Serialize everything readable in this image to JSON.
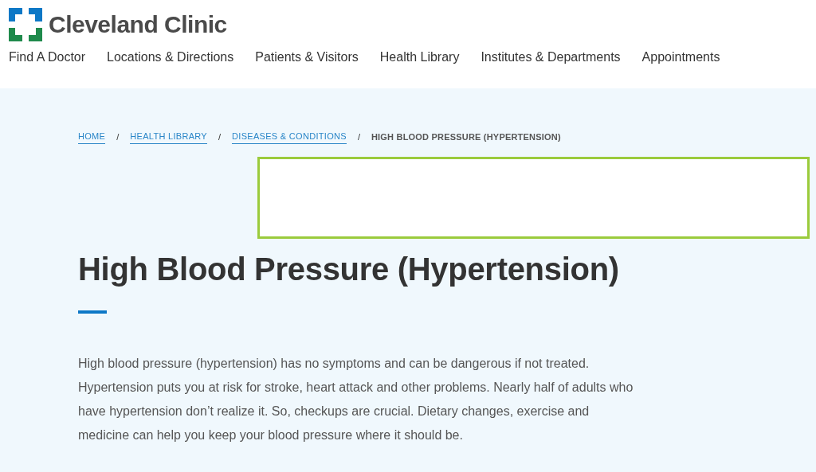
{
  "logo": {
    "text": "Cleveland Clinic"
  },
  "nav": [
    {
      "label": "Find A Doctor"
    },
    {
      "label": "Locations & Directions"
    },
    {
      "label": "Patients & Visitors"
    },
    {
      "label": "Health Library"
    },
    {
      "label": "Institutes & Departments"
    },
    {
      "label": "Appointments"
    }
  ],
  "breadcrumb": [
    {
      "label": "HOME",
      "current": false
    },
    {
      "label": "HEALTH LIBRARY",
      "current": false
    },
    {
      "label": "DISEASES & CONDITIONS",
      "current": false
    },
    {
      "label": "HIGH BLOOD PRESSURE (HYPERTENSION)",
      "current": true
    }
  ],
  "breadcrumb_separator": "/",
  "title": "High Blood Pressure (Hypertension)",
  "intro": "High blood pressure (hypertension) has no symptoms and can be dangerous if not treated. Hypertension puts you at risk for stroke, heart attack and other problems. Nearly half of adults who have hypertension don’t realize it. So, checkups are crucial. Dietary changes, exercise and medicine can help you keep your blood pressure where it should be."
}
